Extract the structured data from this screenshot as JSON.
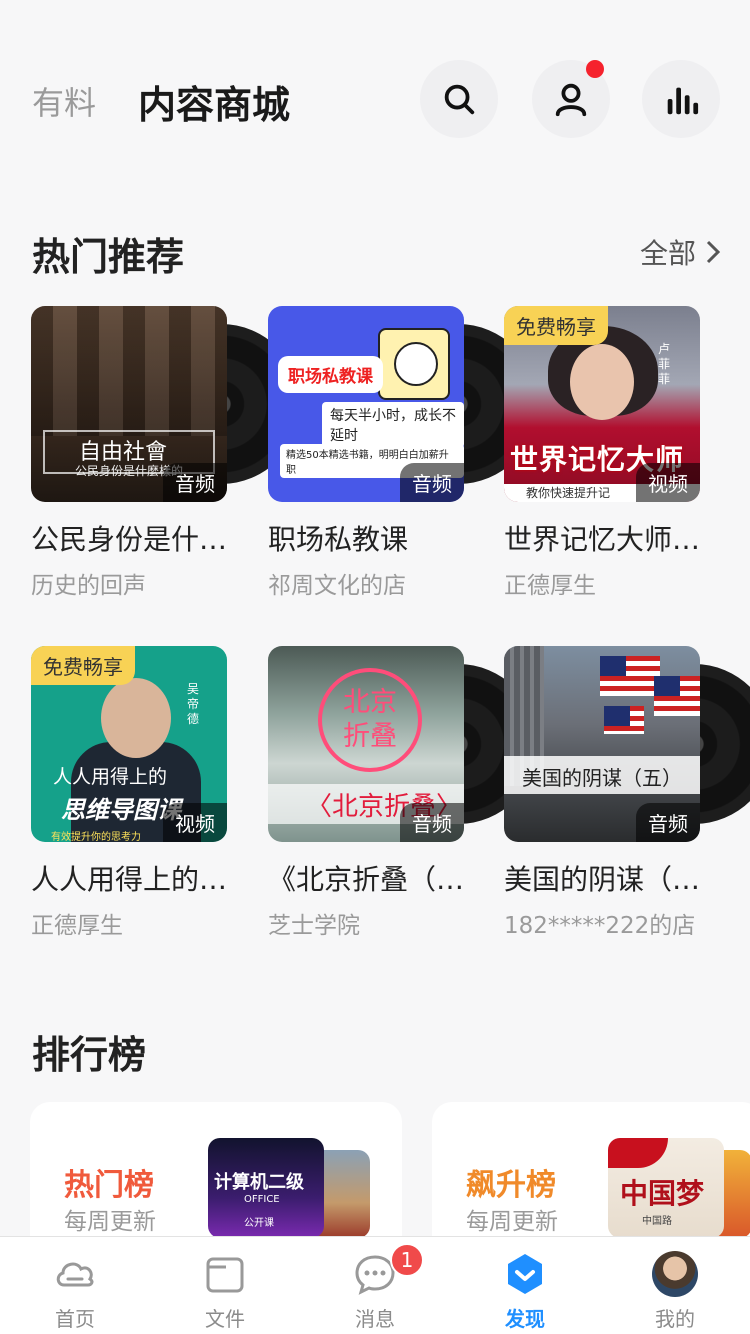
{
  "header": {
    "tab_inactive": "有料",
    "tab_active": "内容商城"
  },
  "hot": {
    "title": "热门推荐",
    "see_all": "全部",
    "items": [
      {
        "title": "公民身份是什…",
        "sub": "历史的回声",
        "type": "音频",
        "free": "",
        "cover_line1": "自由社會",
        "cover_line2": "公民身份是什麼樣的"
      },
      {
        "title": "职场私教课",
        "sub": "祁周文化的店",
        "type": "音频",
        "free": "",
        "cover_line1": "职场私教课",
        "cover_line2": "每天半小时，成长不延时",
        "cover_line3": "精选50本精选书籍，明明白白加薪升职"
      },
      {
        "title": "世界记忆大师…",
        "sub": "正德厚生",
        "type": "视频",
        "free": "免费畅享",
        "cover_line1": "世界记忆大师",
        "cover_line2": "教你快速提升记",
        "cover_side": "卢菲菲"
      },
      {
        "title": "人人用得上的…",
        "sub": "正德厚生",
        "type": "视频",
        "free": "免费畅享",
        "cover_line1": "人人用得上的",
        "cover_line2": "思维导图课",
        "cover_line3": "有效提升你的思考力",
        "cover_side": "吴帝德"
      },
      {
        "title": "《北京折叠（…",
        "sub": "芝士学院",
        "type": "音频",
        "free": "",
        "cover_line1": "北京折叠",
        "cover_line2": "〈北京折叠〉"
      },
      {
        "title": "美国的阴谋（…",
        "sub": "182*****222的店",
        "type": "音频",
        "free": "",
        "cover_line1": "美国的阴谋（五）"
      }
    ]
  },
  "rank": {
    "title": "排行榜",
    "cards": [
      {
        "title": "热门榜",
        "sub": "每周更新",
        "color": "#f05a3c",
        "img_text": "计算机二级",
        "img_text2": "OFFICE",
        "img_text3": "公开课"
      },
      {
        "title": "飙升榜",
        "sub": "每周更新",
        "color": "#f08a2a",
        "img_text": "中国梦",
        "img_text2": "中国路"
      }
    ]
  },
  "nav": {
    "items": [
      {
        "label": "首页",
        "icon": "cloud-icon"
      },
      {
        "label": "文件",
        "icon": "folder-icon"
      },
      {
        "label": "消息",
        "icon": "chat-icon",
        "badge": "1"
      },
      {
        "label": "发现",
        "icon": "discover-icon",
        "active": true
      },
      {
        "label": "我的",
        "icon": "avatar"
      }
    ]
  },
  "colors": {
    "accent": "#1f8fff",
    "badge_red": "#f04a4a",
    "free_yellow": "#f8d255"
  }
}
